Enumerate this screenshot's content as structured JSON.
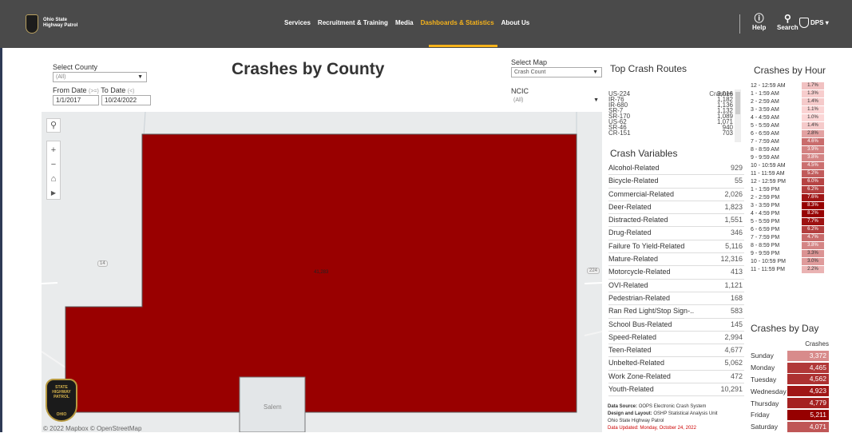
{
  "header": {
    "logo_text_line1": "Ohio State",
    "logo_text_line2": "Highway Patrol",
    "nav": [
      {
        "label": "Services"
      },
      {
        "label": "Recruitment & Training"
      },
      {
        "label": "Media"
      },
      {
        "label": "Dashboards & Statistics",
        "active": true
      },
      {
        "label": "About Us"
      }
    ],
    "help_label": "Help",
    "search_label": "Search",
    "dps_label": "DPS",
    "accent_color": "#f5b21b"
  },
  "filters": {
    "county_label": "Select County",
    "county_value": "(All)",
    "from_label": "From Date",
    "from_hint": "(>=)",
    "to_label": "To Date",
    "to_hint": "(<)",
    "from_value": "1/1/2017",
    "to_value": "10/24/2022",
    "map_label": "Select Map",
    "map_value": "Crash Count",
    "ncic_label": "NCIC",
    "ncic_value": "(All)"
  },
  "page_title": "Crashes by County",
  "map": {
    "region_value": "41,283",
    "region_color": "#990000",
    "road_label_1": "14",
    "road_label_2": "224",
    "town_label": "Salem",
    "copyright": "© 2022 Mapbox  © OpenStreetMap",
    "badge_text_1": "STATE",
    "badge_text_2": "HIGHWAY",
    "badge_text_3": "PATROL",
    "badge_text_4": "OHIO"
  },
  "routes": {
    "title": "Top Crash Routes",
    "column_header": "Crashes",
    "rows": [
      {
        "route": "US-224",
        "crashes": "3,016"
      },
      {
        "route": "IR-76",
        "crashes": "1,182"
      },
      {
        "route": "IR-680",
        "crashes": "1,136"
      },
      {
        "route": "SR-7",
        "crashes": "1,132"
      },
      {
        "route": "SR-170",
        "crashes": "1,089"
      },
      {
        "route": "US-62",
        "crashes": "1,071"
      },
      {
        "route": "SR-46",
        "crashes": "940"
      },
      {
        "route": "CR-151",
        "crashes": "703"
      }
    ]
  },
  "variables": {
    "title": "Crash Variables",
    "rows": [
      {
        "label": "Alcohol-Related",
        "value": "929"
      },
      {
        "label": "Bicycle-Related",
        "value": "55"
      },
      {
        "label": "Commercial-Related",
        "value": "2,026"
      },
      {
        "label": "Deer-Related",
        "value": "1,823"
      },
      {
        "label": "Distracted-Related",
        "value": "1,551"
      },
      {
        "label": "Drug-Related",
        "value": "346"
      },
      {
        "label": "Failure To Yield-Related",
        "value": "5,116"
      },
      {
        "label": "Mature-Related",
        "value": "12,316"
      },
      {
        "label": "Motorcycle-Related",
        "value": "413"
      },
      {
        "label": "OVI-Related",
        "value": "1,121"
      },
      {
        "label": "Pedestrian-Related",
        "value": "168"
      },
      {
        "label": "Ran Red Light/Stop Sign-..",
        "value": "583"
      },
      {
        "label": "School Bus-Related",
        "value": "145"
      },
      {
        "label": "Speed-Related",
        "value": "2,994"
      },
      {
        "label": "Teen-Related",
        "value": "4,677"
      },
      {
        "label": "Unbelted-Related",
        "value": "5,062"
      },
      {
        "label": "Work Zone-Related",
        "value": "472"
      },
      {
        "label": "Youth-Related",
        "value": "10,291"
      }
    ]
  },
  "footer": {
    "source_label": "Data Source:",
    "source_value": "OOPS Electronic Crash System",
    "design_label": "Design and Layout:",
    "design_value": "OSHP Statistical Analysis Unit",
    "org": "Ohio State Highway Patrol",
    "updated": "Data Updated: Monday, October 24, 2022"
  },
  "hours": {
    "title": "Crashes by Hour",
    "rows": [
      {
        "label": "12 - 12:59 AM",
        "value": "1.7%"
      },
      {
        "label": "1 - 1:59 AM",
        "value": "1.3%"
      },
      {
        "label": "2 - 2:59 AM",
        "value": "1.4%"
      },
      {
        "label": "3 - 3:59 AM",
        "value": "1.1%"
      },
      {
        "label": "4 - 4:59 AM",
        "value": "1.0%"
      },
      {
        "label": "5 - 5:59 AM",
        "value": "1.4%"
      },
      {
        "label": "6 - 6:59 AM",
        "value": "2.8%"
      },
      {
        "label": "7 - 7:59 AM",
        "value": "4.6%"
      },
      {
        "label": "8 - 8:59 AM",
        "value": "3.9%"
      },
      {
        "label": "9 - 9:59 AM",
        "value": "3.8%"
      },
      {
        "label": "10 - 10:59 AM",
        "value": "4.5%"
      },
      {
        "label": "11 - 11:59 AM",
        "value": "5.2%"
      },
      {
        "label": "12 - 12:59 PM",
        "value": "6.0%"
      },
      {
        "label": "1 - 1:59 PM",
        "value": "6.2%"
      },
      {
        "label": "2 - 2:59 PM",
        "value": "7.6%"
      },
      {
        "label": "3 - 3:59 PM",
        "value": "8.3%"
      },
      {
        "label": "4 - 4:59 PM",
        "value": "8.2%"
      },
      {
        "label": "5 - 5:59 PM",
        "value": "7.7%"
      },
      {
        "label": "6 - 6:59 PM",
        "value": "6.2%"
      },
      {
        "label": "7 - 7:59 PM",
        "value": "4.7%"
      },
      {
        "label": "8 - 8:59 PM",
        "value": "3.8%"
      },
      {
        "label": "9 - 9:59 PM",
        "value": "3.3%"
      },
      {
        "label": "10 - 10:59 PM",
        "value": "3.0%"
      },
      {
        "label": "11 - 11:59 PM",
        "value": "2.2%"
      }
    ]
  },
  "days": {
    "title": "Crashes by Day",
    "column_header": "Crashes",
    "rows": [
      {
        "label": "Sunday",
        "value": "3,372"
      },
      {
        "label": "Monday",
        "value": "4,465"
      },
      {
        "label": "Tuesday",
        "value": "4,562"
      },
      {
        "label": "Wednesday",
        "value": "4,923"
      },
      {
        "label": "Thursday",
        "value": "4,779"
      },
      {
        "label": "Friday",
        "value": "5,211"
      },
      {
        "label": "Saturday",
        "value": "4,071"
      }
    ]
  }
}
